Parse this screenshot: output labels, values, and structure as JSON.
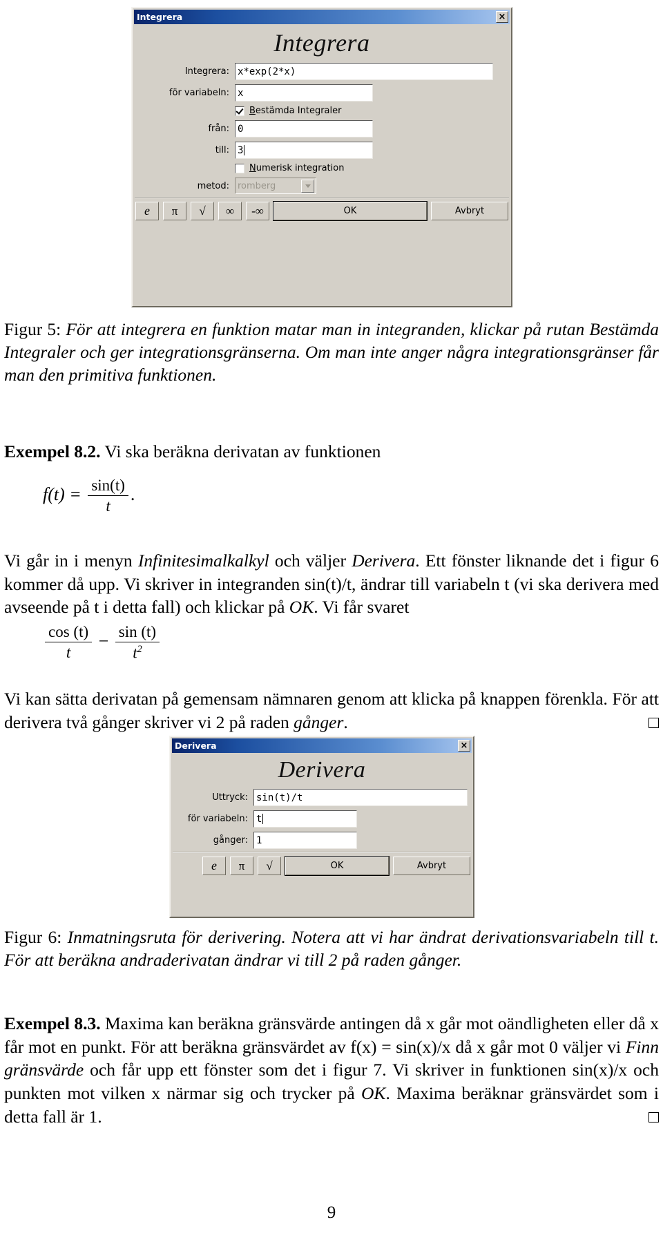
{
  "figure5": {
    "window_title": "Integrera",
    "close_label": "×",
    "heading": "Integrera",
    "fields": [
      {
        "label": "Integrera:",
        "value": "x*exp(2*x)",
        "name": "integrand-input"
      },
      {
        "label": "för variabeln:",
        "value": "x",
        "name": "variable-input"
      }
    ],
    "checkbox_definite": {
      "label_underlined": "B",
      "label_rest": "estämda Integraler",
      "checked": true
    },
    "limit_from": {
      "label": "från:",
      "value": "0"
    },
    "limit_to": {
      "label": "till:",
      "value": "3"
    },
    "checkbox_numeric": {
      "label_underlined": "N",
      "label_rest": "umerisk integration",
      "checked": false
    },
    "method": {
      "label": "metod:",
      "value": "romberg",
      "disabled": true
    },
    "buttons": {
      "e": "e",
      "pi": "π",
      "sqrt": "√",
      "inf": "∞",
      "neginf": "-∞",
      "ok": "OK",
      "cancel": "Avbryt"
    }
  },
  "caption5": {
    "lead": "Figur 5: ",
    "text": "För att integrera en funktion matar man in integranden, klickar på rutan Bestämda Integraler och ger integrationsgränserna. Om man inte anger några integrationsgränser får man den primitiva funktionen."
  },
  "example82": {
    "label": "Exempel 8.2.",
    "intro": " Vi ska beräkna derivatan av funktionen",
    "equation": {
      "lhs": "f(t) =",
      "num": "sin(t)",
      "den": "t",
      "trail": "."
    },
    "paragraph_parts": {
      "p1": "Vi går in i menyn ",
      "menu": "Infinitesimalkalkyl",
      "p2": " och väljer ",
      "menu2": "Derivera",
      "p3": ". Ett fönster liknande det i figur 6 kommer då upp. Vi skriver in integranden sin(t)/t, ändrar till variabeln t (vi ska derivera med avseende på t i detta fall) och klickar på ",
      "ok": "OK",
      "p4": ". Vi får svaret"
    },
    "result": {
      "num1": "cos (t)",
      "den1": "t",
      "op": "−",
      "num2": "sin (t)",
      "den2": "t",
      "den2sup": "2"
    },
    "closing": "Vi kan sätta derivatan på gemensam nämnaren genom att klicka på knappen förenkla. För att derivera två gånger skriver vi 2 på raden ",
    "closing_italic": "gånger",
    "closing_end": "."
  },
  "figure6": {
    "window_title": "Derivera",
    "close_label": "×",
    "heading": "Derivera",
    "fields": [
      {
        "label": "Uttryck:",
        "value": "sin(t)/t",
        "name": "expression-input"
      },
      {
        "label": "för variabeln:",
        "value": "t",
        "name": "variable-input"
      },
      {
        "label": "gånger:",
        "value": "1",
        "name": "times-input"
      }
    ],
    "buttons": {
      "e": "e",
      "pi": "π",
      "sqrt": "√",
      "ok": "OK",
      "cancel": "Avbryt"
    }
  },
  "caption6": {
    "lead": "Figur 6: ",
    "text": "Inmatningsruta för derivering. Notera att vi har ändrat derivationsvariabeln till t. För att beräkna andraderivatan ändrar vi till 2 på raden gånger."
  },
  "example83": {
    "label": "Exempel 8.3.",
    "p1": " Maxima kan beräkna gränsvärde antingen då x går mot oändligheten eller då x får mot en punkt. För att beräkna gränsvärdet av f(x) = sin(x)/x då x går mot 0 väljer vi ",
    "menu": "Finn gränsvärde",
    "p2": " och får upp ett fönster som det i figur 7. Vi skriver in funktionen sin(x)/x och punkten mot vilken x närmar sig och trycker på ",
    "ok": "OK",
    "p3": ". Maxima beräknar gränsvärdet som i detta fall är 1."
  },
  "page_number": "9",
  "colors": {
    "title_bar_start": "#0a246a",
    "title_bar_end": "#a8c6ef",
    "dialog_face": "#d4d0c8"
  }
}
